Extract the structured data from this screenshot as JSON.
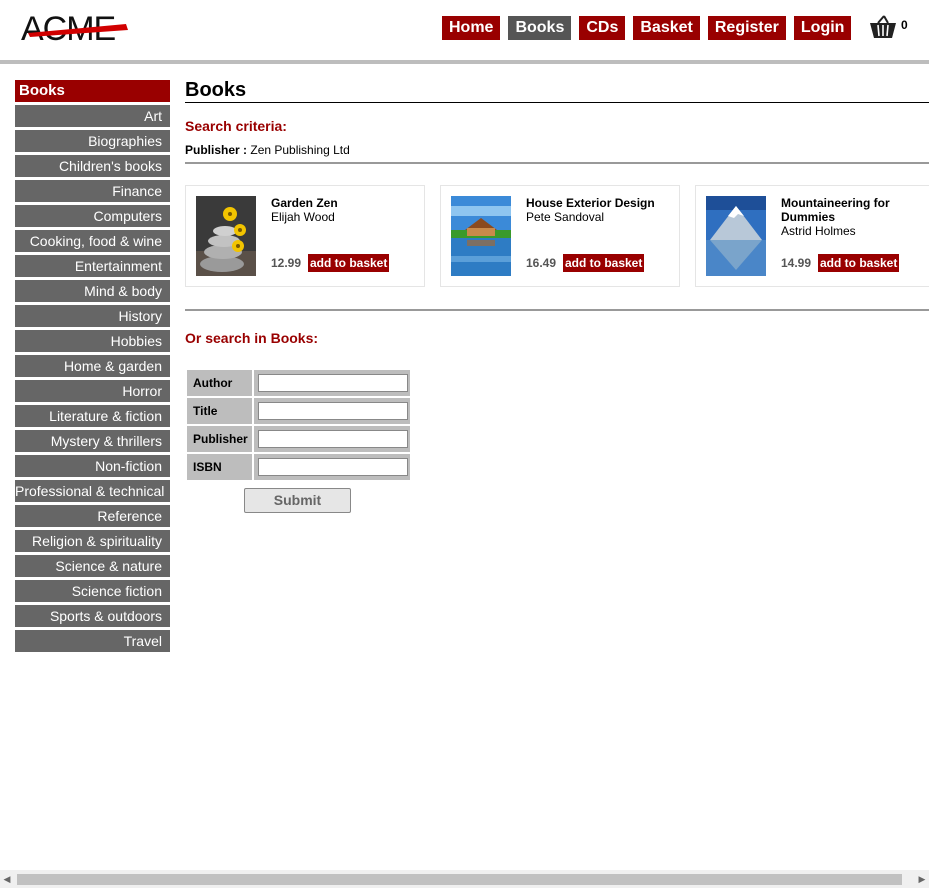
{
  "header": {
    "logo_text": "ACME",
    "nav": [
      {
        "label": "Home",
        "active": false
      },
      {
        "label": "Books",
        "active": true
      },
      {
        "label": "CDs",
        "active": false
      },
      {
        "label": "Basket",
        "active": false
      },
      {
        "label": "Register",
        "active": false
      },
      {
        "label": "Login",
        "active": false
      }
    ],
    "basket_count": "0"
  },
  "sidebar": {
    "heading": "Books",
    "items": [
      "Art",
      "Biographies",
      "Children's books",
      "Finance",
      "Computers",
      "Cooking, food & wine",
      "Entertainment",
      "Mind & body",
      "History",
      "Hobbies",
      "Home & garden",
      "Horror",
      "Literature & fiction",
      "Mystery & thrillers",
      "Non-fiction",
      "Professional & technical",
      "Reference",
      "Religion & spirituality",
      "Science & nature",
      "Science fiction",
      "Sports & outdoors",
      "Travel"
    ]
  },
  "main": {
    "title": "Books",
    "search_criteria_label": "Search criteria:",
    "criteria_key": "Publisher :",
    "criteria_value": "Zen Publishing Ltd",
    "products": [
      {
        "title": "Garden Zen",
        "author": "Elijah Wood",
        "price": "12.99",
        "button": "add to basket",
        "image": "zen-stones-flowers"
      },
      {
        "title": "House Exterior Design",
        "author": "Pete Sandoval",
        "price": "16.49",
        "button": "add to basket",
        "image": "house-lake"
      },
      {
        "title": "Mountaineering for Dummies",
        "author": "Astrid Holmes",
        "price": "14.99",
        "button": "add to basket",
        "image": "mountain-lake"
      }
    ],
    "or_search_label": "Or search in Books:",
    "form": {
      "fields": [
        {
          "label": "Author",
          "value": ""
        },
        {
          "label": "Title",
          "value": ""
        },
        {
          "label": "Publisher",
          "value": ""
        },
        {
          "label": "ISBN",
          "value": ""
        }
      ],
      "submit": "Submit"
    }
  },
  "colors": {
    "accent": "#990000",
    "nav_active": "#555555",
    "sidebar_item": "#666666"
  }
}
